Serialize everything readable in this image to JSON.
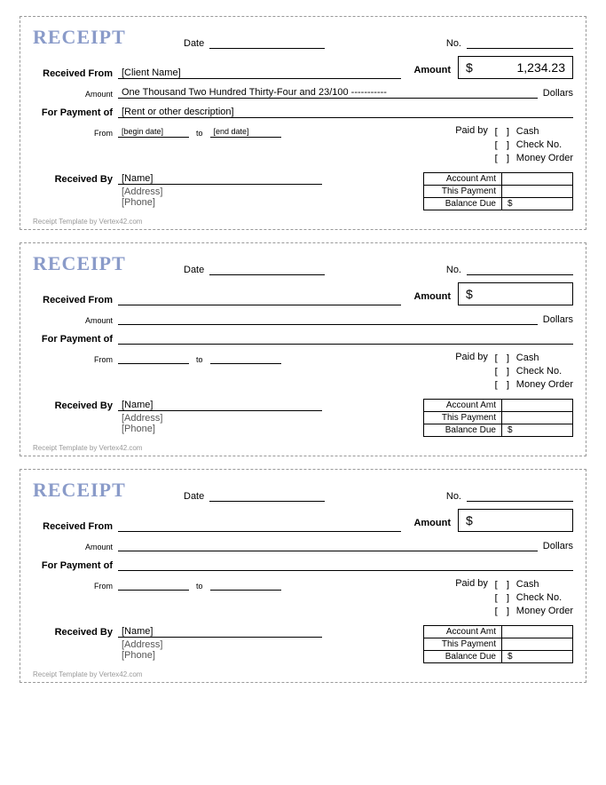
{
  "labels": {
    "title": "RECEIPT",
    "date": "Date",
    "no": "No.",
    "received_from": "Received From",
    "amount_label": "Amount",
    "amount_word_label": "Amount",
    "dollars": "Dollars",
    "for_payment_of": "For Payment of",
    "from": "From",
    "to": "to",
    "paid_by": "Paid by",
    "cash": "Cash",
    "check_no": "Check No.",
    "money_order": "Money Order",
    "received_by": "Received By",
    "account_amt": "Account Amt",
    "this_payment": "This Payment",
    "balance_due": "Balance Due",
    "currency": "$",
    "checkbox": "[  ]",
    "footer": "Receipt Template by Vertex42.com"
  },
  "receipts": [
    {
      "date": "",
      "no": "",
      "received_from": "[Client Name]",
      "amount_numeric": "1,234.23",
      "amount_words": "One Thousand Two Hundred Thirty-Four and 23/100 -----------",
      "for_payment_of": "[Rent or other description]",
      "from_date": "[begin date]",
      "to_date": "[end date]",
      "received_by_name": "[Name]",
      "received_by_address": "[Address]",
      "received_by_phone": "[Phone]",
      "account_amt": "",
      "this_payment": "",
      "balance_due": "$"
    },
    {
      "date": "",
      "no": "",
      "received_from": "",
      "amount_numeric": "",
      "amount_words": "",
      "for_payment_of": "",
      "from_date": "",
      "to_date": "",
      "received_by_name": "[Name]",
      "received_by_address": "[Address]",
      "received_by_phone": "[Phone]",
      "account_amt": "",
      "this_payment": "",
      "balance_due": "$"
    },
    {
      "date": "",
      "no": "",
      "received_from": "",
      "amount_numeric": "",
      "amount_words": "",
      "for_payment_of": "",
      "from_date": "",
      "to_date": "",
      "received_by_name": "[Name]",
      "received_by_address": "[Address]",
      "received_by_phone": "[Phone]",
      "account_amt": "",
      "this_payment": "",
      "balance_due": "$"
    }
  ]
}
